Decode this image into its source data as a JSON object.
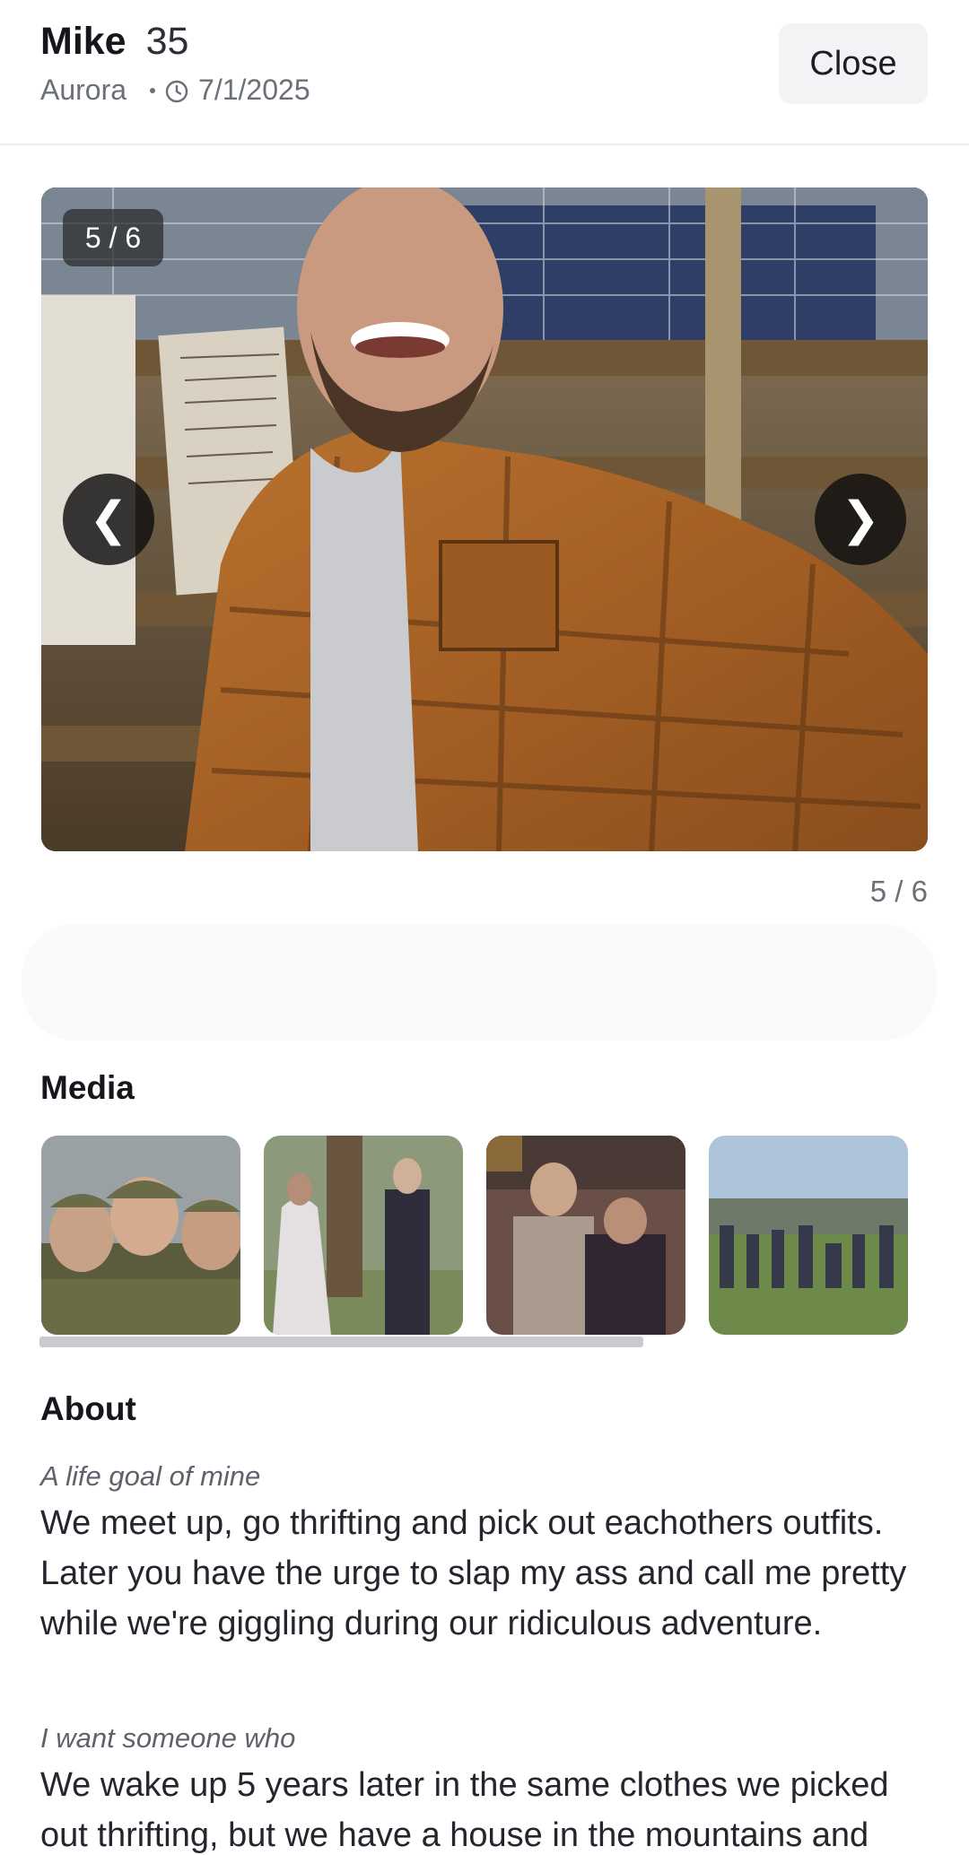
{
  "profile": {
    "name": "Mike",
    "age": "35",
    "location": "Aurora",
    "date": "7/1/2025"
  },
  "header": {
    "close_label": "Close",
    "clock_icon": "clock-icon"
  },
  "carousel": {
    "badge": "5 / 6",
    "counter": "5 / 6",
    "prev_glyph": "❮",
    "next_glyph": "❯",
    "current": 5,
    "total": 6
  },
  "media": {
    "title": "Media",
    "scroll_fraction": 0.68
  },
  "about": {
    "title": "About",
    "prompts": [
      {
        "label": "A life goal of mine",
        "answer": "We meet up, go thrifting and pick out eachothers outfits. Later you have the urge to slap my ass and call me pretty while we're giggling during our ridiculous adventure."
      },
      {
        "label": "I want someone who",
        "answer": "We wake up 5 years later in the same clothes we picked out thrifting, but we have a house in the mountains and"
      }
    ]
  },
  "colors": {
    "accent_dark": "#15171c",
    "muted_text": "#6b6f78",
    "close_bg": "#f1f3f5",
    "scrollbar": "#c8cacd"
  }
}
